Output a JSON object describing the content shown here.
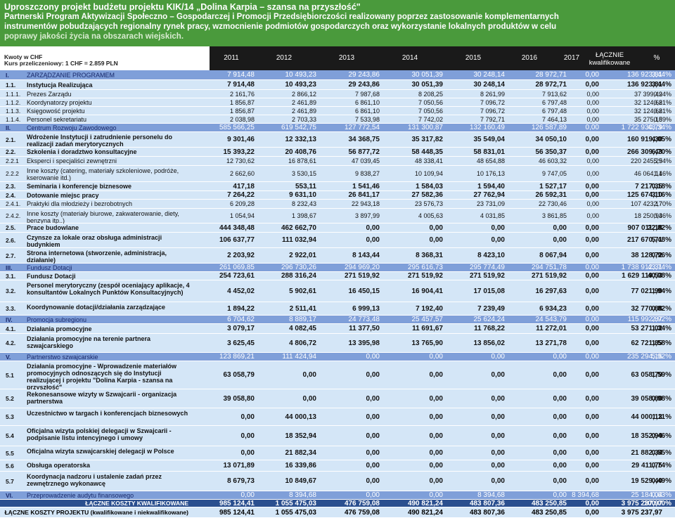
{
  "banner": {
    "line1": "Uproszczony projekt budżetu projektu KIK/14 „Dolina Karpia – szansa na przyszłość\"",
    "line2": "Partnerski Program Aktywizacji Społeczno – Gospodarczej i Promocji Przedsiębiorczości realizowany poprzez zastosowanie komplementarnych",
    "line3": "instrumentów pobudzających regionalny rynek pracy, wzmocnienie podmiotów gospodarczych oraz wykorzystanie lokalnych produktów w celu",
    "line4": "poprawy jakości życia na obszarach wiejskich."
  },
  "currency": {
    "label": "Kwoty w CHF",
    "rate": "Kurs przeliczeniowy: 1 CHF = 2.859 PLN"
  },
  "header": {
    "columns": [
      "2011",
      "2012",
      "2013",
      "2014",
      "2015",
      "2016",
      "2017"
    ],
    "total_l1": "ŁĄCZNIE",
    "total_l2": "kwalifikowane",
    "pct": "%"
  },
  "rows": [
    {
      "type": "sec",
      "h": 14,
      "code": "I.",
      "name": "ZARZĄDZANIE PROGRAMEM",
      "vals": [
        "7 914,48",
        "10 493,23",
        "29 243,86",
        "30 051,39",
        "30 248,14",
        "28 972,71",
        "0,00",
        "136 923,81",
        "3,44%"
      ]
    },
    {
      "type": "sub",
      "h": 14,
      "code": "1.1.",
      "name": "Instytucja Realizująca",
      "vals": [
        "7 914,48",
        "10 493,23",
        "29 243,86",
        "30 051,39",
        "30 248,14",
        "28 972,71",
        "0,00",
        "136 923,81",
        "3,44%"
      ]
    },
    {
      "type": "det",
      "h": 12,
      "code": "1.1.1.",
      "name": "Prezes Zarządu",
      "vals": [
        "2 161,76",
        "2 866,12",
        "7 987,68",
        "8 208,25",
        "8 261,99",
        "7 913,62",
        "0,00",
        "37 399,42",
        "0,94%"
      ]
    },
    {
      "type": "det",
      "h": 12,
      "code": "1.1.2.",
      "name": "Koordynatorzy projektu",
      "vals": [
        "1 856,87",
        "2 461,89",
        "6 861,10",
        "7 050,56",
        "7 096,72",
        "6 797,48",
        "0,00",
        "32 124,62",
        "0,81%"
      ]
    },
    {
      "type": "det",
      "h": 12,
      "code": "1.1.3.",
      "name": "Księgowość projektu",
      "vals": [
        "1 856,87",
        "2 461,89",
        "6 861,10",
        "7 050,56",
        "7 096,72",
        "6 797,48",
        "0,00",
        "32 124,62",
        "0,81%"
      ]
    },
    {
      "type": "det",
      "h": 12,
      "code": "1.1.4.",
      "name": "Personel sekretariatu",
      "vals": [
        "2 038,98",
        "2 703,33",
        "7 533,98",
        "7 742,02",
        "7 792,71",
        "7 464,13",
        "0,00",
        "35 275,15",
        "0,89%"
      ]
    },
    {
      "type": "sec",
      "h": 12,
      "code": "II.",
      "name": "Centrum Rozwoju Zawodowego",
      "vals": [
        "585 566,25",
        "619 542,75",
        "127 772,54",
        "131 300,87",
        "132 160,49",
        "126 587,89",
        "0,00",
        "1 722 930,79",
        "43,34%"
      ]
    },
    {
      "type": "sub",
      "h": 22,
      "code": "2.1.",
      "name": "Wdrożenie Instytucji i zatrudnienie personelu do realizacji zadań merytorycznych",
      "vals": [
        "9 301,46",
        "12 332,13",
        "34 368,75",
        "35 317,82",
        "35 549,04",
        "34 050,10",
        "0,00",
        "160 919,30",
        "4,05%"
      ]
    },
    {
      "type": "sub",
      "h": 13,
      "code": "2.2.",
      "name": "Szkolenia i doradztwo konsultacyjne",
      "vals": [
        "15 393,22",
        "20 408,76",
        "56 877,72",
        "58 448,35",
        "58 831,01",
        "56 350,37",
        "0,00",
        "266 309,43",
        "6,70%"
      ]
    },
    {
      "type": "det",
      "h": 13,
      "code": "2.2.1",
      "name": "Eksperci i specjaliści zewnętrzni",
      "vals": [
        "12 730,62",
        "16 878,61",
        "47 039,45",
        "48 338,41",
        "48 654,88",
        "46 603,32",
        "0,00",
        "220 245,29",
        "5,54%"
      ]
    },
    {
      "type": "det",
      "h": 23,
      "code": "2.2.2",
      "name": "Inne koszty (catering, materiały szkoleniowe, podróże, kserowanie itd.)",
      "vals": [
        "2 662,60",
        "3 530,15",
        "9 838,27",
        "10 109,94",
        "10 176,13",
        "9 747,05",
        "0,00",
        "46 064,14",
        "1,16%"
      ]
    },
    {
      "type": "sub",
      "h": 13,
      "code": "2.3.",
      "name": "Seminaria i konferencje biznesowe",
      "vals": [
        "417,18",
        "553,11",
        "1 541,46",
        "1 584,03",
        "1 594,40",
        "1 527,17",
        "0,00",
        "7 217,35",
        "0,18%"
      ]
    },
    {
      "type": "sub",
      "h": 12,
      "code": "2.4.",
      "name": "Dotowanie miejsc pracy",
      "vals": [
        "7 264,22",
        "9 631,10",
        "26 841,17",
        "27 582,36",
        "27 762,94",
        "26 592,31",
        "0,00",
        "125 674,10",
        "3,16%"
      ]
    },
    {
      "type": "det",
      "h": 13,
      "code": "2.4.1.",
      "name": "Praktyki dla młodzieży i bezrobotnych",
      "vals": [
        "6 209,28",
        "8 232,43",
        "22 943,18",
        "23 576,73",
        "23 731,09",
        "22 730,46",
        "0,00",
        "107 423,17",
        "2,70%"
      ]
    },
    {
      "type": "det",
      "h": 21,
      "code": "2.4.2.",
      "name": "Inne koszty (materiały biurowe, zakwaterowanie, diety, benzyna itp..)",
      "vals": [
        "1 054,94",
        "1 398,67",
        "3 897,99",
        "4 005,63",
        "4 031,85",
        "3 861,85",
        "0,00",
        "18 250,93",
        "0,46%"
      ]
    },
    {
      "type": "sub",
      "h": 13,
      "code": "2.5.",
      "name": "Prace budowlane",
      "vals": [
        "444 348,48",
        "462 662,70",
        "0,00",
        "0,00",
        "0,00",
        "0,00",
        "0,00",
        "907 011,18",
        "22,82%"
      ]
    },
    {
      "type": "sub",
      "h": 22,
      "code": "2.6.",
      "name": "Czynsze za lokale oraz obsługa administracji budynkiem",
      "vals": [
        "106 637,77",
        "111 032,94",
        "0,00",
        "0,00",
        "0,00",
        "0,00",
        "0,00",
        "217 670,71",
        "5,48%"
      ]
    },
    {
      "type": "sub",
      "h": 22,
      "code": "2.7.",
      "name": "Strona internetowa (stworzenie, administracja, działanie)",
      "vals": [
        "2 203,92",
        "2 922,01",
        "8 143,44",
        "8 368,31",
        "8 423,10",
        "8 067,94",
        "0,00",
        "38 128,72",
        "0,96%"
      ]
    },
    {
      "type": "sec",
      "h": 12,
      "code": "III.",
      "name": "Fundusz Dotacji",
      "vals": [
        "261 069,85",
        "296 730,26",
        "294 969,20",
        "295 616,73",
        "295 774,49",
        "294 751,78",
        "0,00",
        "1 738 912,31",
        "43,74%"
      ]
    },
    {
      "type": "sub",
      "h": 12,
      "code": "3.1.",
      "name": "Fundusz Dotacji",
      "vals": [
        "254 723,61",
        "288 316,24",
        "271 519,92",
        "271 519,92",
        "271 519,92",
        "271 519,92",
        "0,00",
        "1 629 119,53",
        "40,98%"
      ]
    },
    {
      "type": "sub",
      "h": 31,
      "code": "3.2.",
      "name": "Personel merytoryczny (zespół oceniający aplikacje, 4 konsultantów Lokalnych Punktów Konsultacyjnych)",
      "vals": [
        "4 452,02",
        "5 902,61",
        "16 450,15",
        "16 904,41",
        "17 015,08",
        "16 297,63",
        "0,00",
        "77 021,90",
        "1,94%"
      ]
    },
    {
      "type": "sub",
      "h": 19,
      "code": "3.3.",
      "name": "Koordynowanie dotacji/działania zarządzające",
      "vals": [
        "1 894,22",
        "2 511,41",
        "6 999,13",
        "7 192,40",
        "7 239,49",
        "6 934,23",
        "0,00",
        "32 770,88",
        "0,82%"
      ]
    },
    {
      "type": "sec",
      "h": 12,
      "code": "IV.",
      "name": "Promocja subregionu",
      "vals": [
        "6 704,62",
        "8 889,17",
        "24 773,48",
        "25 457,57",
        "25 624,24",
        "24 543,79",
        "0,00",
        "115 992,87",
        "2,92%"
      ]
    },
    {
      "type": "sub",
      "h": 14,
      "code": "4.1.",
      "name": "Działania promocyjne",
      "vals": [
        "3 079,17",
        "4 082,45",
        "11 377,50",
        "11 691,67",
        "11 768,22",
        "11 272,01",
        "0,00",
        "53 271,02",
        "1,34%"
      ]
    },
    {
      "type": "sub",
      "h": 27,
      "code": "4.2.",
      "name": "Działania promocyjne na terenie partnera szwajcarskiego",
      "vals": [
        "3 625,45",
        "4 806,72",
        "13 395,98",
        "13 765,90",
        "13 856,02",
        "13 271,78",
        "0,00",
        "62 721,85",
        "1,58%"
      ]
    },
    {
      "type": "sec",
      "h": 12,
      "code": "V.",
      "name": "Partnerstwo szwajcarskie",
      "vals": [
        "123 869,21",
        "111 424,94",
        "0,00",
        "0,00",
        "0,00",
        "0,00",
        "0,00",
        "235 294,15",
        "5,92%"
      ]
    },
    {
      "type": "sub",
      "h": 40,
      "code": "5.1",
      "name": "Działania promocyjne - Wprowadzenie materiałów promocyjnych odnoszących się do Instytucji realizującej i projektu \"Dolina Karpia - szansa na przyszłość\"",
      "vals": [
        "63 058,79",
        "0,00",
        "0,00",
        "0,00",
        "0,00",
        "0,00",
        "0,00",
        "63 058,79",
        "1,59%"
      ]
    },
    {
      "type": "sub",
      "h": 27,
      "code": "5.2",
      "name": "Rekonesansowe wizyty w Szwajcarii - organizacja partnerstwa",
      "vals": [
        "39 058,80",
        "0,00",
        "0,00",
        "0,00",
        "0,00",
        "0,00",
        "0,00",
        "39 058,80",
        "0,98%"
      ]
    },
    {
      "type": "sub",
      "h": 25,
      "code": "5.3",
      "name": "Uczestnictwo w targach i konferencjach biznesowych",
      "vals": [
        "0,00",
        "44 000,13",
        "0,00",
        "0,00",
        "0,00",
        "0,00",
        "0,00",
        "44 000,13",
        "1,11%"
      ]
    },
    {
      "type": "sub",
      "h": 29,
      "code": "5.4",
      "name": "Oficjalna wizyta polskiej delegacji w Szwajcarii - podpisanie listu intencyjnego i umowy",
      "vals": [
        "0,00",
        "18 352,94",
        "0,00",
        "0,00",
        "0,00",
        "0,00",
        "0,00",
        "18 352,94",
        "0,46%"
      ]
    },
    {
      "type": "sub",
      "h": 20,
      "code": "5.5",
      "name": "Oficjalna wizyta szwajcarskiej delegacji w Polsce",
      "vals": [
        "0,00",
        "21 882,34",
        "0,00",
        "0,00",
        "0,00",
        "0,00",
        "0,00",
        "21 882,34",
        "0,55%"
      ]
    },
    {
      "type": "sub",
      "h": 16,
      "code": "5.6",
      "name": "Obsługa operatorska",
      "vals": [
        "13 071,89",
        "16 339,86",
        "0,00",
        "0,00",
        "0,00",
        "0,00",
        "0,00",
        "29 411,75",
        "0,74%"
      ]
    },
    {
      "type": "sub",
      "h": 28,
      "code": "5.7",
      "name": "Koordynacja nadzoru i ustalenie zadań przez zewnętrznego wykonawcę",
      "vals": [
        "8 679,73",
        "10 849,67",
        "0,00",
        "0,00",
        "0,00",
        "0,00",
        "0,00",
        "19 529,40",
        "0,49%"
      ]
    },
    {
      "type": "sec",
      "h": 12,
      "code": "VI.",
      "name": "Przeprowadzenie audytu finansowego",
      "vals": [
        "0,00",
        "8 394,68",
        "0,00",
        "0,00",
        "8 394,68",
        "0,00",
        "8 394,68",
        "25 184,04",
        "0,63%"
      ]
    },
    {
      "type": "tot",
      "h": 11,
      "code": "",
      "name": "ŁĄCZNE KOSZTY KWALIFIKOWANE",
      "vals": [
        "985 124,41",
        "1 055 475,03",
        "476 759,08",
        "490 821,24",
        "483 807,36",
        "483 250,85",
        "0,00",
        "3 975 237,97",
        "100,00%"
      ]
    },
    {
      "type": "gtot",
      "h": 15,
      "code": "",
      "name": "ŁĄCZNE KOSZTY PROJEKTU (kwalifikowane i niekwalifikowane)",
      "vals": [
        "985 124,41",
        "1 055 475,03",
        "476 759,08",
        "490 821,24",
        "483 807,36",
        "483 250,85",
        "0,00",
        "3 975 237,97",
        ""
      ]
    }
  ]
}
